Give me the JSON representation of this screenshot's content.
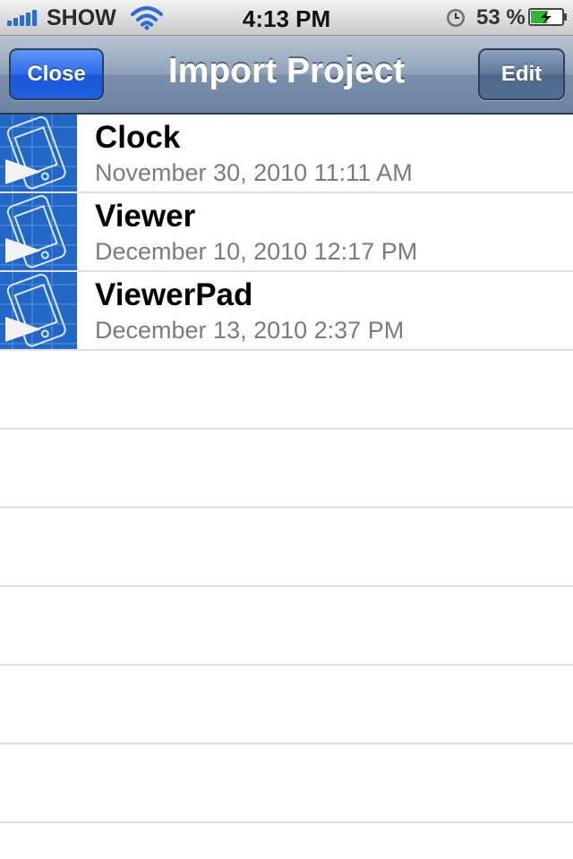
{
  "status_bar": {
    "carrier": "SHOW",
    "time": "4:13 PM",
    "battery_percent": "53 %",
    "signal_icon": "signal-bars-icon",
    "wifi_icon": "wifi-icon",
    "alarm_icon": "clock-icon",
    "battery_icon": "battery-charging-icon",
    "battery_level": 0.53
  },
  "nav": {
    "title": "Import Project",
    "close_label": "Close",
    "edit_label": "Edit"
  },
  "projects": [
    {
      "name": "Clock",
      "date": "November 30, 2010 11:11 AM"
    },
    {
      "name": "Viewer",
      "date": "December 10, 2010 12:17 PM"
    },
    {
      "name": "ViewerPad",
      "date": "December 13, 2010 2:37 PM"
    }
  ],
  "colors": {
    "accent_blue": "#1f5fe0",
    "nav_bar": "#6d83a2",
    "thumbnail_blue": "#2367c6",
    "subtitle_gray": "#7b7b7b"
  }
}
